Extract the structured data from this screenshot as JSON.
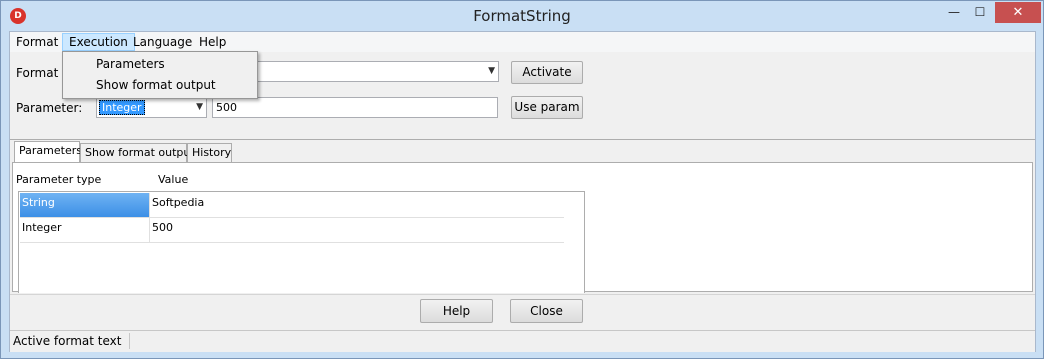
{
  "window": {
    "title": "FormatString",
    "icon": "app-icon",
    "icon_glyph": "D",
    "controls": {
      "minimize": "—",
      "maximize": "☐",
      "close": "✕"
    }
  },
  "menu": {
    "items": [
      "Format",
      "Execution",
      "Language",
      "Help"
    ],
    "open_menu": "Execution",
    "dropdown_items": [
      "Parameters",
      "Show format output"
    ]
  },
  "form": {
    "format_label": "Format st",
    "format_value": "",
    "activate_button": "Activate",
    "parameter_label": "Parameter:",
    "parameter_type": "Integer",
    "parameter_value": "500",
    "use_param_button": "Use param"
  },
  "tabs": [
    "Parameters",
    "Show format output",
    "History"
  ],
  "active_tab": "Parameters",
  "table": {
    "columns": [
      "Parameter type",
      "Value"
    ],
    "rows": [
      {
        "type": "String",
        "value": "Softpedia",
        "selected": true
      },
      {
        "type": "Integer",
        "value": "500",
        "selected": false
      }
    ]
  },
  "footer": {
    "help_button": "Help",
    "close_button": "Close"
  },
  "status": {
    "text": "Active format text"
  }
}
